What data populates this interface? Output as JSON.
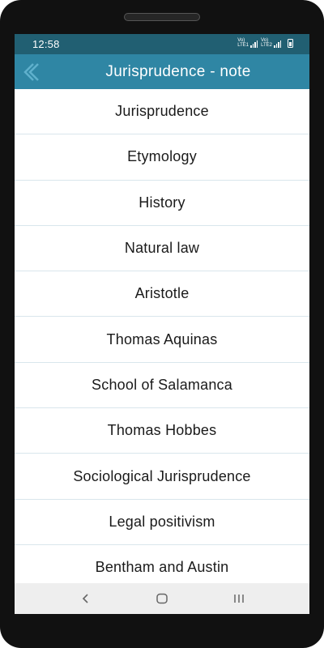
{
  "status_bar": {
    "time": "12:58",
    "sim1_label": [
      "Vo)",
      "LTE1"
    ],
    "sim2_label": [
      "Vo)",
      "LTE2"
    ]
  },
  "app_bar": {
    "title": "Jurisprudence - note",
    "back_icon": "chevron-left-icon"
  },
  "list": {
    "items": [
      "Jurisprudence",
      "Etymology",
      "History",
      "Natural law",
      "Aristotle",
      "Thomas Aquinas",
      "School of Salamanca",
      "Thomas Hobbes",
      "Sociological Jurisprudence",
      "Legal positivism",
      "Bentham and Austin"
    ]
  },
  "nav_bar": {
    "back_icon": "nav-back-icon",
    "home_icon": "nav-home-icon",
    "recents_icon": "nav-recents-icon"
  },
  "colors": {
    "status_bar": "#215f72",
    "app_bar": "#2f86a4",
    "divider": "#d9e6ec",
    "nav_bar": "#eeeeee"
  }
}
